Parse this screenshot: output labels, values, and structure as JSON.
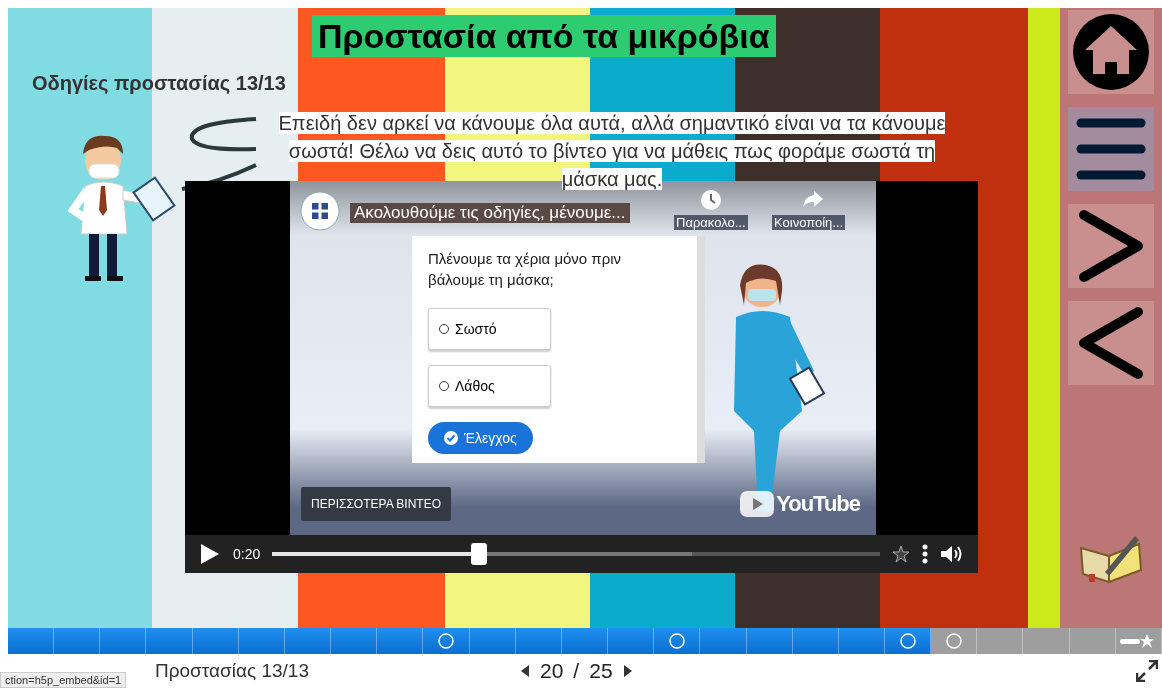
{
  "slide": {
    "title": "Προστασία από τα μικρόβια",
    "subtitle": "Οδηγίες προστασίας 13/13",
    "speech": "Επειδή δεν αρκεί να κάνουμε όλα αυτά, αλλά σημαντικό είναι να τα κάνουμε σωστά! Θέλω να δεις αυτό το βίντεο για να μάθεις πως φοράμε σωστά τη μάσκα μας.",
    "video": {
      "title": "Ακολουθούμε τις οδηγίες, μένουμε...",
      "watch_later": "Παρακολο...",
      "share": "Κοινοποίη...",
      "more_videos": "ΠΕΡΙΣΣΟΤΕΡΑ ΒΙΝΤΕΟ",
      "logo": "YouTube",
      "time": "0:20",
      "level": 0.34,
      "buffer": {
        "level": 0.69
      },
      "quiz": {
        "question": "Πλένουμε τα χέρια μόνο πριν βάλουμε τη μάσκα;",
        "options": [
          {
            "label": "Σωστό",
            "selected": false
          },
          {
            "label": "Λάθος",
            "selected": false
          }
        ],
        "check": "Έλεγχος"
      }
    }
  },
  "sidebar": [
    {
      "kind": "home",
      "highlighted": false
    },
    {
      "kind": "menu",
      "highlighted": true
    },
    {
      "kind": "next",
      "highlighted": false
    },
    {
      "kind": "prev",
      "highlighted": false
    }
  ],
  "progress": [
    {
      "kind": "plain",
      "completed": true
    },
    {
      "kind": "plain",
      "completed": true
    },
    {
      "kind": "plain",
      "completed": true
    },
    {
      "kind": "plain",
      "completed": true
    },
    {
      "kind": "plain",
      "completed": true
    },
    {
      "kind": "plain",
      "completed": true
    },
    {
      "kind": "plain",
      "completed": true
    },
    {
      "kind": "plain",
      "completed": true
    },
    {
      "kind": "plain",
      "completed": true
    },
    {
      "kind": "circle",
      "completed": true
    },
    {
      "kind": "plain",
      "completed": true
    },
    {
      "kind": "plain",
      "completed": true
    },
    {
      "kind": "plain",
      "completed": true
    },
    {
      "kind": "plain",
      "completed": true
    },
    {
      "kind": "circle",
      "completed": true
    },
    {
      "kind": "plain",
      "completed": true
    },
    {
      "kind": "plain",
      "completed": true
    },
    {
      "kind": "plain",
      "completed": true
    },
    {
      "kind": "plain",
      "completed": true
    },
    {
      "kind": "circle",
      "completed": true
    },
    {
      "kind": "circle",
      "completed": false
    },
    {
      "kind": "plain",
      "completed": false
    },
    {
      "kind": "plain",
      "completed": false
    },
    {
      "kind": "plain",
      "completed": false
    },
    {
      "kind": "star",
      "completed": false
    }
  ],
  "footer": {
    "title": "Προστασίας 13/13",
    "status_url": "ction=h5p_embed&id=1",
    "current": "20",
    "separator": "/",
    "total": "25"
  }
}
